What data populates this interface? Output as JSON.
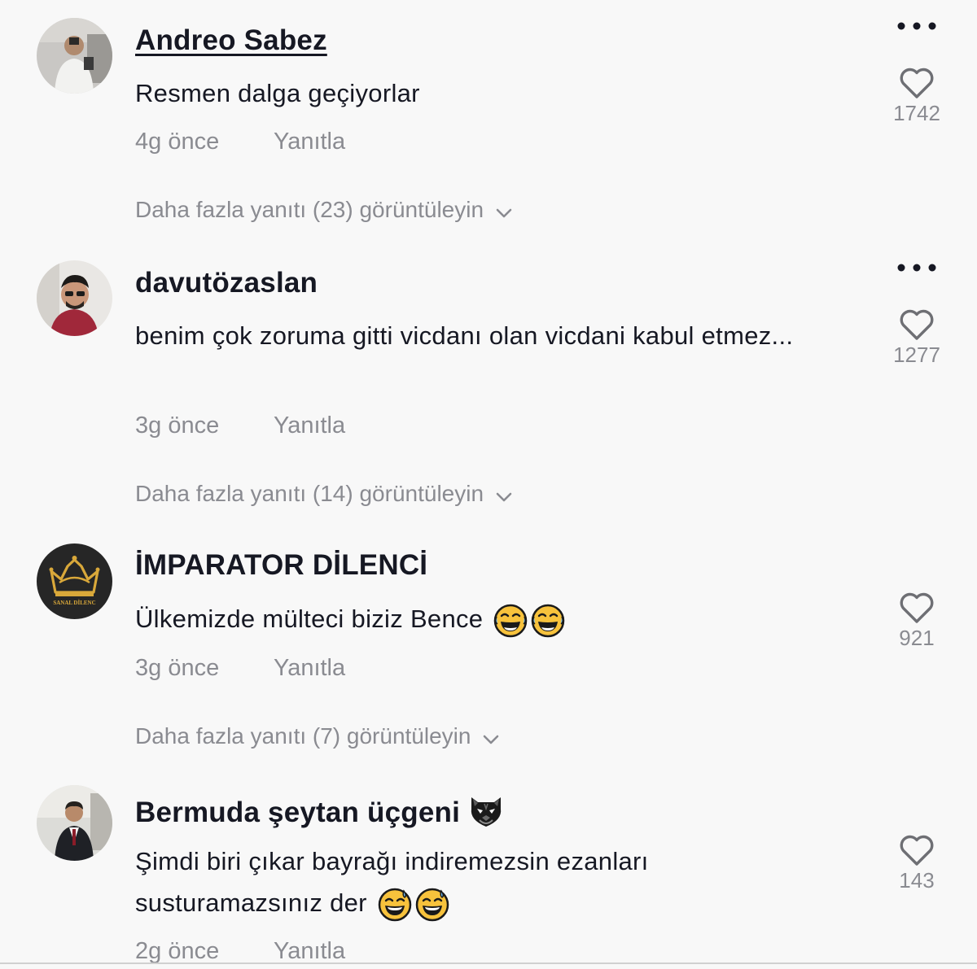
{
  "comments": [
    {
      "username": "Andreo Sabez",
      "text": "Resmen dalga geçiyorlar",
      "time": "4g önce",
      "reply_label": "Yanıtla",
      "likes": "1742",
      "more_replies": "Daha fazla yanıtı (23) görüntüleyin",
      "avatar_icon": "avatar-photo-man-mirror-selfie"
    },
    {
      "username": "davutözaslan",
      "text": "benim çok zoruma gitti vicdanı olan vicdani kabul etmez...",
      "time": "3g önce",
      "reply_label": "Yanıtla",
      "likes": "1277",
      "more_replies": "Daha fazla yanıtı (14) görüntüleyin",
      "avatar_icon": "avatar-photo-man-glasses"
    },
    {
      "username": "İMPARATOR DİLENCİ",
      "text": "Ülkemizde mülteci biziz Bence",
      "text_emojis": [
        "tears-of-joy-emoji",
        "tears-of-joy-emoji"
      ],
      "time": "3g önce",
      "reply_label": "Yanıtla",
      "likes": "921",
      "more_replies": "Daha fazla yanıtı (7) görüntüleyin",
      "avatar_icon": "avatar-gold-crown-logo",
      "avatar_caption": "SANAL DİLENC"
    },
    {
      "username": "Bermuda şeytan üçgeni",
      "username_emoji": "black-tiger-face-emoji",
      "text": "Şimdi biri çıkar bayrağı indiremezsin ezanları susturamazsınız der",
      "text_emojis": [
        "grinning-sweat-emoji",
        "grinning-sweat-emoji"
      ],
      "time": "2g önce",
      "reply_label": "Yanıtla",
      "likes": "143",
      "avatar_icon": "avatar-photo-man-suit"
    }
  ],
  "colors": {
    "background": "#f8f8f8",
    "primary_text": "#161823",
    "secondary_text": "#8a8b91",
    "emoji_yellow": "#f7c23c"
  }
}
